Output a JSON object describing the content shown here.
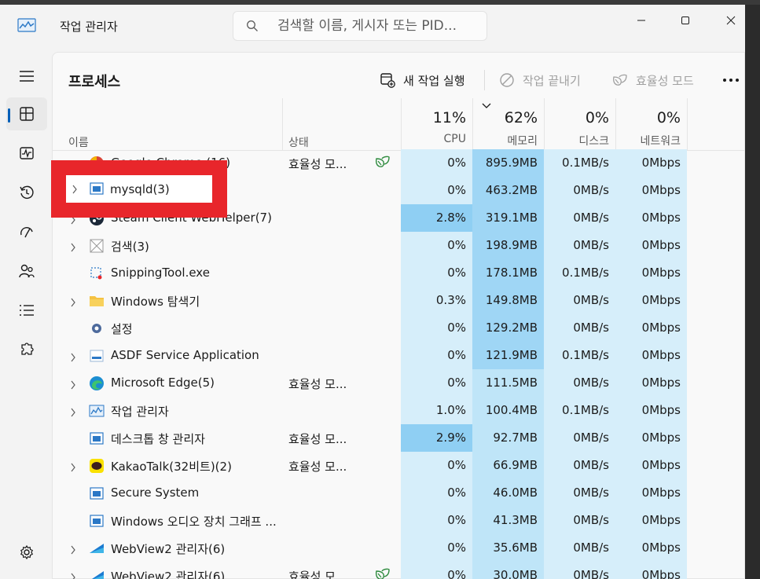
{
  "window": {
    "title": "작업 관리자"
  },
  "search": {
    "placeholder": "검색할 이름, 게시자 또는 PID..."
  },
  "toolbar": {
    "page_title": "프로세스",
    "run_task": "새 작업 실행",
    "end_task": "작업 끝내기",
    "efficiency_mode": "효율성 모드"
  },
  "columns": {
    "name": "이름",
    "status": "상태",
    "cpu": {
      "percent": "11%",
      "label": "CPU"
    },
    "memory": {
      "percent": "62%",
      "label": "메모리"
    },
    "disk": {
      "percent": "0%",
      "label": "디스크"
    },
    "network": {
      "percent": "0%",
      "label": "네트워크"
    }
  },
  "processes": [
    {
      "name": "Google Chrome (16)",
      "icon": "chrome-icon",
      "expandable": true,
      "status": "효율성 모...",
      "leaf": true,
      "cpu": "0%",
      "memory": "895.9MB",
      "disk": "0.1MB/s",
      "network": "0Mbps"
    },
    {
      "name": "mysqld(3)",
      "icon": "app-window-icon",
      "expandable": true,
      "status": "",
      "leaf": false,
      "cpu": "0%",
      "memory": "463.2MB",
      "disk": "0MB/s",
      "network": "0Mbps"
    },
    {
      "name": "Steam Client WebHelper(7)",
      "icon": "steam-icon",
      "expandable": true,
      "status": "",
      "leaf": false,
      "cpu": "2.8%",
      "memory": "319.1MB",
      "disk": "0MB/s",
      "network": "0Mbps"
    },
    {
      "name": "검색(3)",
      "icon": "search-app-icon",
      "expandable": true,
      "status": "",
      "leaf": false,
      "cpu": "0%",
      "memory": "198.9MB",
      "disk": "0MB/s",
      "network": "0Mbps"
    },
    {
      "name": "SnippingTool.exe",
      "icon": "snipping-tool-icon",
      "expandable": false,
      "status": "",
      "leaf": false,
      "cpu": "0%",
      "memory": "178.1MB",
      "disk": "0.1MB/s",
      "network": "0Mbps"
    },
    {
      "name": "Windows 탐색기",
      "icon": "folder-icon",
      "expandable": true,
      "status": "",
      "leaf": false,
      "cpu": "0.3%",
      "memory": "149.8MB",
      "disk": "0MB/s",
      "network": "0Mbps"
    },
    {
      "name": "설정",
      "icon": "settings-gear-icon",
      "expandable": false,
      "status": "",
      "leaf": false,
      "cpu": "0%",
      "memory": "129.2MB",
      "disk": "0MB/s",
      "network": "0Mbps"
    },
    {
      "name": "ASDF Service Application",
      "icon": "service-app-icon",
      "expandable": true,
      "status": "",
      "leaf": false,
      "cpu": "0%",
      "memory": "121.9MB",
      "disk": "0.1MB/s",
      "network": "0Mbps"
    },
    {
      "name": "Microsoft Edge(5)",
      "icon": "edge-icon",
      "expandable": true,
      "status": "효율성 모...",
      "leaf": false,
      "cpu": "0%",
      "memory": "111.5MB",
      "disk": "0MB/s",
      "network": "0Mbps"
    },
    {
      "name": "작업 관리자",
      "icon": "task-manager-icon",
      "expandable": true,
      "status": "",
      "leaf": false,
      "cpu": "1.0%",
      "memory": "100.4MB",
      "disk": "0.1MB/s",
      "network": "0Mbps"
    },
    {
      "name": "데스크톱 창 관리자",
      "icon": "app-window-icon",
      "expandable": false,
      "status": "효율성 모...",
      "leaf": false,
      "cpu": "2.9%",
      "memory": "92.7MB",
      "disk": "0MB/s",
      "network": "0Mbps"
    },
    {
      "name": "KakaoTalk(32비트)(2)",
      "icon": "kakaotalk-icon",
      "expandable": true,
      "status": "효율성 모...",
      "leaf": false,
      "cpu": "0%",
      "memory": "66.9MB",
      "disk": "0MB/s",
      "network": "0Mbps"
    },
    {
      "name": "Secure System",
      "icon": "app-window-icon",
      "expandable": false,
      "status": "",
      "leaf": false,
      "cpu": "0%",
      "memory": "46.0MB",
      "disk": "0MB/s",
      "network": "0Mbps"
    },
    {
      "name": "Windows 오디오 장치 그래프 ...",
      "icon": "app-window-icon",
      "expandable": false,
      "status": "",
      "leaf": false,
      "cpu": "0%",
      "memory": "41.3MB",
      "disk": "0MB/s",
      "network": "0Mbps"
    },
    {
      "name": "WebView2 관리자(6)",
      "icon": "webview2-icon",
      "expandable": true,
      "status": "",
      "leaf": false,
      "cpu": "0%",
      "memory": "35.6MB",
      "disk": "0MB/s",
      "network": "0Mbps"
    },
    {
      "name": "WebView2 관리자(6)",
      "icon": "webview2-icon",
      "expandable": true,
      "status": "효율성 모...",
      "leaf": true,
      "cpu": "0%",
      "memory": "30.0MB",
      "disk": "0MB/s",
      "network": "0Mbps"
    }
  ],
  "colors": {
    "accent": "#005fb8",
    "highlight_annotation": "#e8262b"
  }
}
